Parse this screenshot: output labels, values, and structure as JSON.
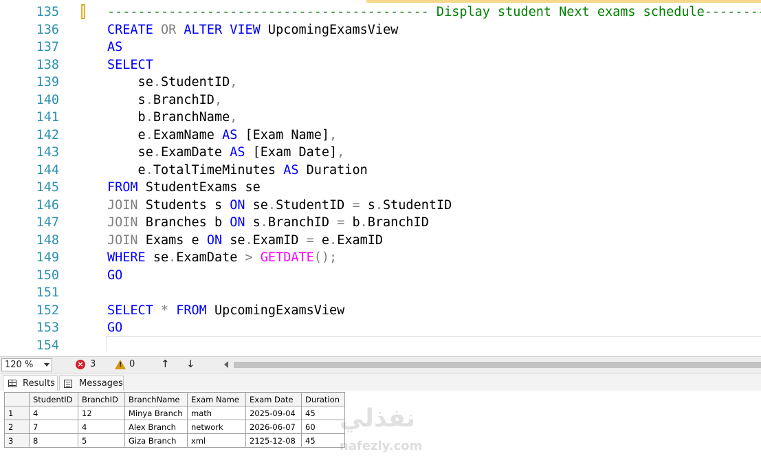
{
  "editor": {
    "lines": [
      {
        "n": "135",
        "tokens": [
          {
            "t": "------------------------------------------ Display student Next exams schedule------------------------",
            "c": "cm"
          }
        ]
      },
      {
        "n": "136",
        "tokens": [
          {
            "t": "CREATE",
            "c": "kw"
          },
          {
            "t": " ",
            "c": "tx"
          },
          {
            "t": "OR",
            "c": "gr"
          },
          {
            "t": " ",
            "c": "tx"
          },
          {
            "t": "ALTER",
            "c": "kw"
          },
          {
            "t": " ",
            "c": "tx"
          },
          {
            "t": "VIEW",
            "c": "kw"
          },
          {
            "t": " UpcomingExamsView",
            "c": "tx"
          }
        ]
      },
      {
        "n": "137",
        "tokens": [
          {
            "t": "AS",
            "c": "kw"
          }
        ]
      },
      {
        "n": "138",
        "tokens": [
          {
            "t": "SELECT",
            "c": "kw"
          }
        ]
      },
      {
        "n": "139",
        "tokens": [
          {
            "t": "    se",
            "c": "tx"
          },
          {
            "t": ".",
            "c": "gr"
          },
          {
            "t": "StudentID",
            "c": "tx"
          },
          {
            "t": ",",
            "c": "gr"
          }
        ]
      },
      {
        "n": "140",
        "tokens": [
          {
            "t": "    s",
            "c": "tx"
          },
          {
            "t": ".",
            "c": "gr"
          },
          {
            "t": "BranchID",
            "c": "tx"
          },
          {
            "t": ",",
            "c": "gr"
          }
        ]
      },
      {
        "n": "141",
        "tokens": [
          {
            "t": "    b",
            "c": "tx"
          },
          {
            "t": ".",
            "c": "gr"
          },
          {
            "t": "BranchName",
            "c": "tx"
          },
          {
            "t": ",",
            "c": "gr"
          }
        ]
      },
      {
        "n": "142",
        "tokens": [
          {
            "t": "    e",
            "c": "tx"
          },
          {
            "t": ".",
            "c": "gr"
          },
          {
            "t": "ExamName ",
            "c": "tx"
          },
          {
            "t": "AS",
            "c": "kw"
          },
          {
            "t": " [Exam Name]",
            "c": "tx"
          },
          {
            "t": ",",
            "c": "gr"
          }
        ]
      },
      {
        "n": "143",
        "tokens": [
          {
            "t": "    se",
            "c": "tx"
          },
          {
            "t": ".",
            "c": "gr"
          },
          {
            "t": "ExamDate ",
            "c": "tx"
          },
          {
            "t": "AS",
            "c": "kw"
          },
          {
            "t": " [Exam Date]",
            "c": "tx"
          },
          {
            "t": ",",
            "c": "gr"
          }
        ]
      },
      {
        "n": "144",
        "tokens": [
          {
            "t": "    e",
            "c": "tx"
          },
          {
            "t": ".",
            "c": "gr"
          },
          {
            "t": "TotalTimeMinutes ",
            "c": "tx"
          },
          {
            "t": "AS",
            "c": "kw"
          },
          {
            "t": " Duration",
            "c": "tx"
          }
        ]
      },
      {
        "n": "145",
        "tokens": [
          {
            "t": "FROM",
            "c": "kw"
          },
          {
            "t": " StudentExams se",
            "c": "tx"
          }
        ]
      },
      {
        "n": "146",
        "tokens": [
          {
            "t": "JOIN",
            "c": "gr"
          },
          {
            "t": " Students s ",
            "c": "tx"
          },
          {
            "t": "ON",
            "c": "kw"
          },
          {
            "t": " se",
            "c": "tx"
          },
          {
            "t": ".",
            "c": "gr"
          },
          {
            "t": "StudentID ",
            "c": "tx"
          },
          {
            "t": "=",
            "c": "gr"
          },
          {
            "t": " s",
            "c": "tx"
          },
          {
            "t": ".",
            "c": "gr"
          },
          {
            "t": "StudentID",
            "c": "tx"
          }
        ]
      },
      {
        "n": "147",
        "tokens": [
          {
            "t": "JOIN",
            "c": "gr"
          },
          {
            "t": " Branches b ",
            "c": "tx"
          },
          {
            "t": "ON",
            "c": "kw"
          },
          {
            "t": " s",
            "c": "tx"
          },
          {
            "t": ".",
            "c": "gr"
          },
          {
            "t": "BranchID ",
            "c": "tx"
          },
          {
            "t": "=",
            "c": "gr"
          },
          {
            "t": " b",
            "c": "tx"
          },
          {
            "t": ".",
            "c": "gr"
          },
          {
            "t": "BranchID",
            "c": "tx"
          }
        ]
      },
      {
        "n": "148",
        "tokens": [
          {
            "t": "JOIN",
            "c": "gr"
          },
          {
            "t": " Exams e ",
            "c": "tx"
          },
          {
            "t": "ON",
            "c": "kw"
          },
          {
            "t": " se",
            "c": "tx"
          },
          {
            "t": ".",
            "c": "gr"
          },
          {
            "t": "ExamID ",
            "c": "tx"
          },
          {
            "t": "=",
            "c": "gr"
          },
          {
            "t": " e",
            "c": "tx"
          },
          {
            "t": ".",
            "c": "gr"
          },
          {
            "t": "ExamID",
            "c": "tx"
          }
        ]
      },
      {
        "n": "149",
        "tokens": [
          {
            "t": "WHERE",
            "c": "kw"
          },
          {
            "t": " se",
            "c": "tx"
          },
          {
            "t": ".",
            "c": "gr"
          },
          {
            "t": "ExamDate ",
            "c": "tx"
          },
          {
            "t": ">",
            "c": "gr"
          },
          {
            "t": " ",
            "c": "tx"
          },
          {
            "t": "GETDATE",
            "c": "fn"
          },
          {
            "t": "();",
            "c": "gr"
          }
        ]
      },
      {
        "n": "150",
        "tokens": [
          {
            "t": "GO",
            "c": "kw"
          }
        ]
      },
      {
        "n": "151",
        "tokens": []
      },
      {
        "n": "152",
        "tokens": [
          {
            "t": "SELECT",
            "c": "kw"
          },
          {
            "t": " ",
            "c": "tx"
          },
          {
            "t": "*",
            "c": "gr"
          },
          {
            "t": " ",
            "c": "tx"
          },
          {
            "t": "FROM",
            "c": "kw"
          },
          {
            "t": " UpcomingExamsView",
            "c": "tx"
          }
        ]
      },
      {
        "n": "153",
        "tokens": [
          {
            "t": "GO",
            "c": "kw"
          }
        ]
      },
      {
        "n": "154",
        "tokens": []
      }
    ],
    "colors": {
      "keyword": "#0000ff",
      "operator": "#808080",
      "function": "#ff00ff",
      "comment": "#008000",
      "line_number": "#2b91af"
    }
  },
  "status": {
    "zoom": "120 %",
    "errors": "3",
    "warnings": "0",
    "error_icon": "error-circle-icon",
    "warning_icon": "warning-triangle-icon"
  },
  "tabs": {
    "results_label": "Results",
    "messages_label": "Messages"
  },
  "grid": {
    "columns": [
      "",
      "StudentID",
      "BranchID",
      "BranchName",
      "Exam Name",
      "Exam Date",
      "Duration"
    ],
    "rows": [
      [
        "1",
        "4",
        "12",
        "Minya Branch",
        "math",
        "2025-09-04",
        "45"
      ],
      [
        "2",
        "7",
        "4",
        "Alex Branch",
        "network",
        "2026-06-07",
        "60"
      ],
      [
        "3",
        "8",
        "5",
        "Giza Branch",
        "xml",
        "2125-12-08",
        "45"
      ]
    ]
  },
  "watermark": {
    "arabic": "نفذلي",
    "latin": "nafezly.com"
  }
}
